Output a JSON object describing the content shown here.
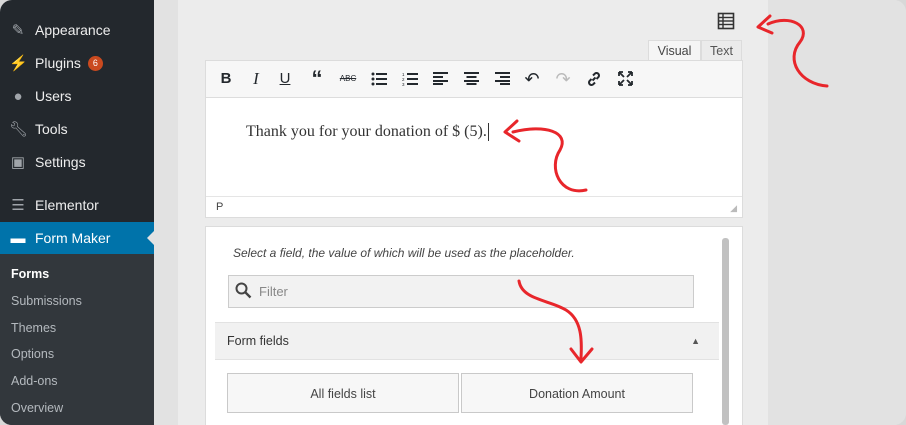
{
  "sidebar": {
    "items": [
      {
        "label": "Appearance",
        "icon": "paintbrush-icon"
      },
      {
        "label": "Plugins",
        "icon": "plug-icon",
        "badge": "6"
      },
      {
        "label": "Users",
        "icon": "users-icon"
      },
      {
        "label": "Tools",
        "icon": "wrench-icon"
      },
      {
        "label": "Settings",
        "icon": "settings-icon"
      },
      {
        "label": "Elementor",
        "icon": "elementor-icon"
      },
      {
        "label": "Form Maker",
        "icon": "form-icon"
      }
    ],
    "submenu": [
      "Forms",
      "Submissions",
      "Themes",
      "Options",
      "Add-ons",
      "Overview"
    ]
  },
  "editor": {
    "tabs": {
      "visual": "Visual",
      "text": "Text"
    },
    "content": "Thank you for your donation of $ (5).",
    "status_path": "P"
  },
  "placeholder_panel": {
    "hint": "Select a field, the value of which will be used as the placeholder.",
    "filter_placeholder": "Filter",
    "section_title": "Form fields",
    "buttons": [
      "All fields list",
      "Donation Amount"
    ]
  },
  "colors": {
    "sidebar_bg": "#23282d",
    "submenu_bg": "#32373c",
    "active": "#0073aa",
    "badge": "#ca4a1f",
    "annotation_arrow": "#e8262b"
  }
}
